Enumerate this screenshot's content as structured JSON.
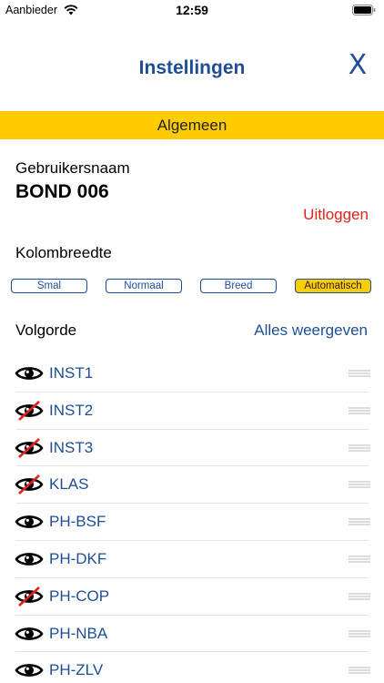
{
  "status_bar": {
    "carrier": "Aanbieder",
    "time": "12:59"
  },
  "nav": {
    "title": "Instellingen",
    "close_label": "X"
  },
  "section": {
    "title": "Algemeen"
  },
  "user": {
    "label": "Gebruikersnaam",
    "value": "BOND 006",
    "logout_label": "Uitloggen"
  },
  "column_width": {
    "label": "Kolombreedte",
    "options": [
      "Smal",
      "Normaal",
      "Breed",
      "Automatisch"
    ],
    "selected": "Automatisch"
  },
  "order": {
    "label": "Volgorde",
    "show_all_label": "Alles weergeven",
    "items": [
      {
        "name": "INST1",
        "visible": true
      },
      {
        "name": "INST2",
        "visible": false
      },
      {
        "name": "INST3",
        "visible": false
      },
      {
        "name": "KLAS",
        "visible": false
      },
      {
        "name": "PH-BSF",
        "visible": true
      },
      {
        "name": "PH-DKF",
        "visible": true
      },
      {
        "name": "PH-COP",
        "visible": false
      },
      {
        "name": "PH-NBA",
        "visible": true
      },
      {
        "name": "PH-ZLV",
        "visible": true
      }
    ]
  },
  "colors": {
    "accent": "#1f4e96",
    "highlight": "#ffcc00",
    "danger": "#e0231e"
  }
}
